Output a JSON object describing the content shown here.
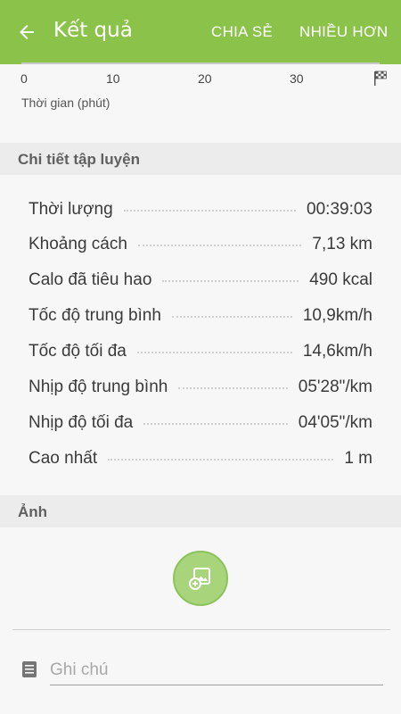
{
  "appbar": {
    "title": "Kết quả",
    "share": "CHIA SẺ",
    "more": "NHIỀU HƠN",
    "back_icon": "arrow-left-icon",
    "color": "#8bc34a"
  },
  "axis": {
    "ticks": [
      "0",
      "10",
      "20",
      "30"
    ],
    "title": "Thời gian (phút)",
    "end_icon": "checkered-flag-icon"
  },
  "details": {
    "header": "Chi tiết tập luyện",
    "rows": [
      {
        "label": "Thời lượng",
        "value": "00:39:03"
      },
      {
        "label": "Khoảng cách",
        "value": "7,13 km"
      },
      {
        "label": "Calo đã tiêu hao",
        "value": "490 kcal"
      },
      {
        "label": "Tốc độ trung bình",
        "value": "10,9km/h"
      },
      {
        "label": "Tốc độ tối đa",
        "value": "14,6km/h"
      },
      {
        "label": "Nhịp độ trung bình",
        "value": "05'28\"/km"
      },
      {
        "label": "Nhịp độ tối đa",
        "value": "04'05\"/km"
      },
      {
        "label": "Cao nhất",
        "value": "1 m"
      }
    ]
  },
  "photo": {
    "header": "Ảnh",
    "add_icon": "add-photo-icon"
  },
  "note": {
    "placeholder": "Ghi chú",
    "icon": "note-icon"
  }
}
